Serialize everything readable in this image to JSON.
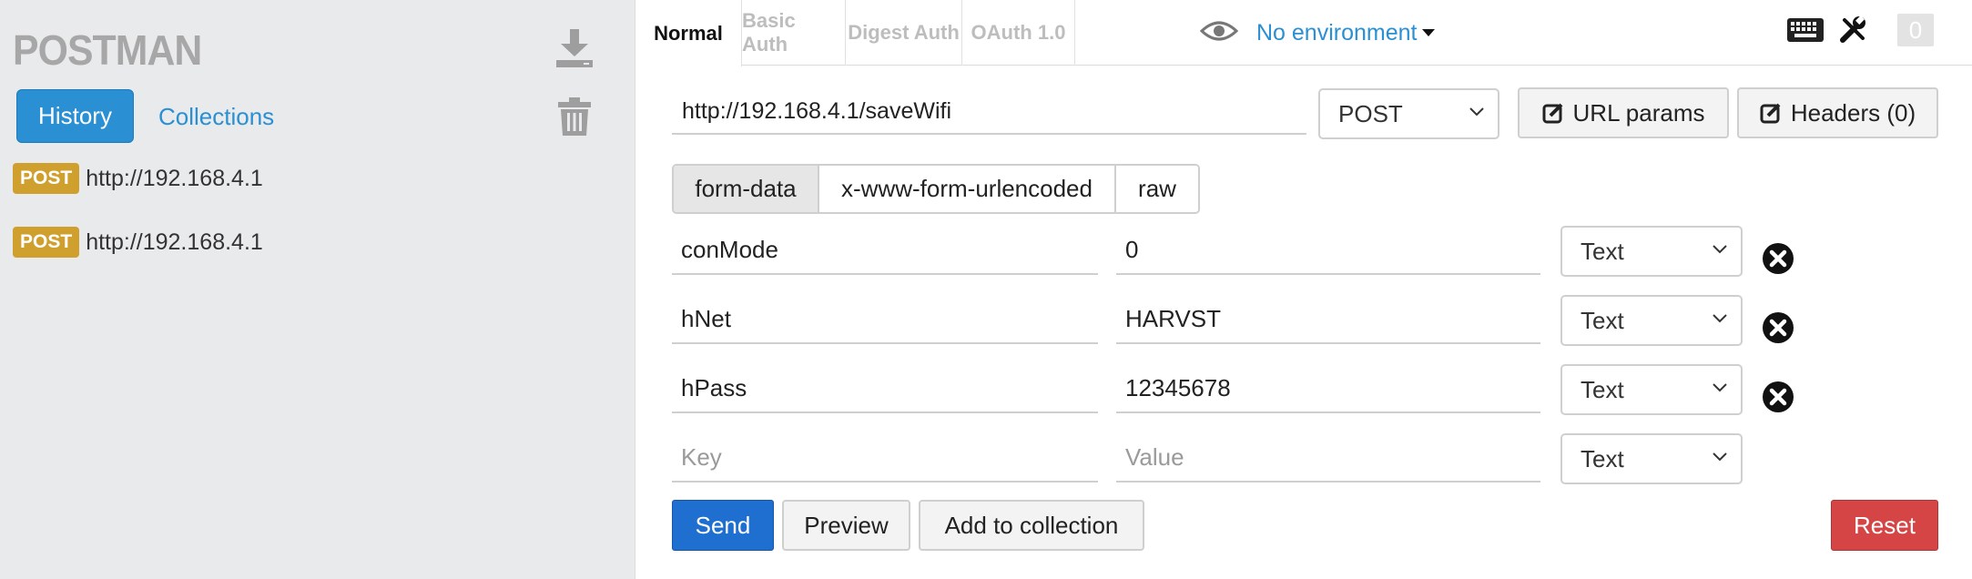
{
  "sidebar": {
    "logo": "POSTMAN",
    "tabs": {
      "history": "History",
      "collections": "Collections"
    },
    "history": [
      {
        "method": "POST",
        "url": "http://192.168.4.1"
      },
      {
        "method": "POST",
        "url": "http://192.168.4.1"
      }
    ]
  },
  "tabs": {
    "normal": "Normal",
    "basic_auth": "Basic Auth",
    "digest_auth": "Digest Auth",
    "oauth": "OAuth 1.0"
  },
  "environment": "No environment",
  "counter": "0",
  "request": {
    "url": "http://192.168.4.1/saveWifi",
    "method": "POST",
    "url_params_label": "URL params",
    "headers_label": "Headers (0)"
  },
  "body_tabs": {
    "form_data": "form-data",
    "urlencoded": "x-www-form-urlencoded",
    "raw": "raw"
  },
  "form_rows": [
    {
      "key": "conMode",
      "value": "0",
      "type": "Text"
    },
    {
      "key": "hNet",
      "value": "HARVST",
      "type": "Text"
    },
    {
      "key": "hPass",
      "value": "12345678",
      "type": "Text"
    }
  ],
  "new_row": {
    "key_placeholder": "Key",
    "value_placeholder": "Value",
    "type": "Text"
  },
  "actions": {
    "send": "Send",
    "preview": "Preview",
    "add_to_collection": "Add to collection",
    "reset": "Reset"
  },
  "colors": {
    "accent": "#2a8fd3",
    "post_badge": "#d0a02e",
    "send": "#1f6fd0",
    "reset": "#d64545"
  }
}
